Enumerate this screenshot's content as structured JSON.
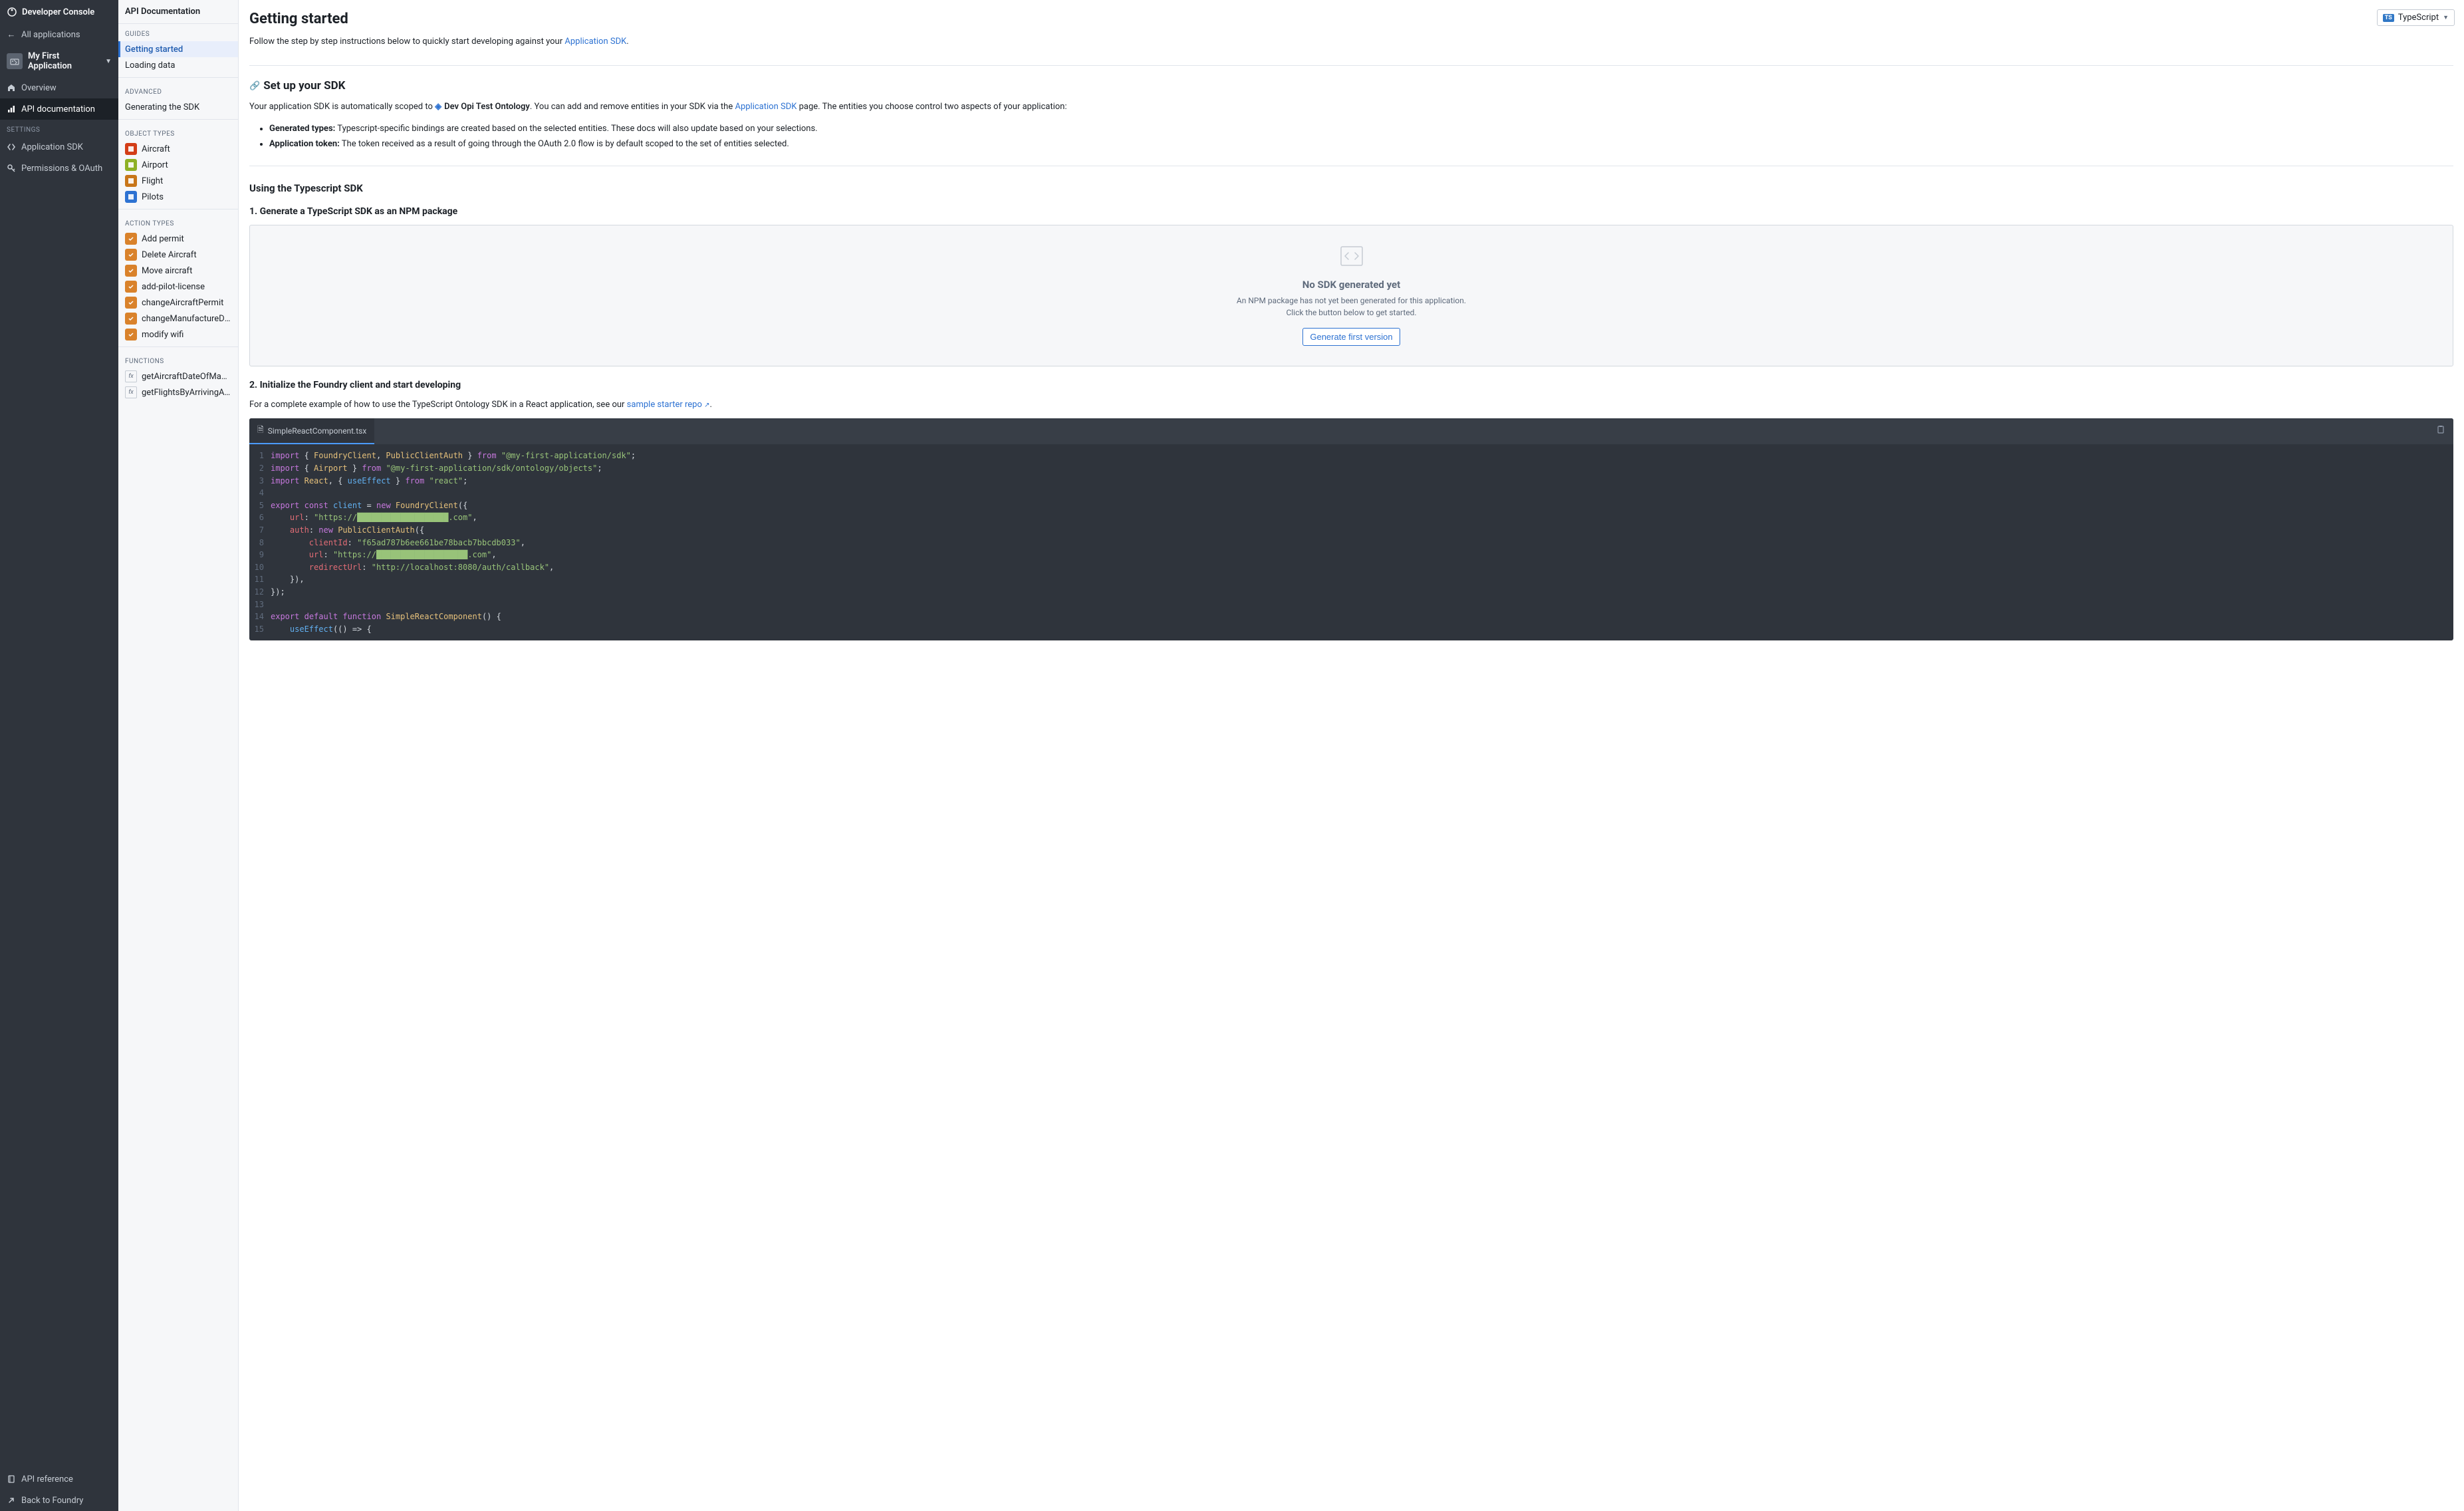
{
  "leftSidebar": {
    "title": "Developer Console",
    "allApps": "All applications",
    "appName": "My First Application",
    "nav": [
      {
        "icon": "home",
        "label": "Overview"
      },
      {
        "icon": "chart",
        "label": "API documentation",
        "active": true
      }
    ],
    "settingsLabel": "SETTINGS",
    "settings": [
      {
        "icon": "code",
        "label": "Application SDK"
      },
      {
        "icon": "key",
        "label": "Permissions & OAuth"
      }
    ],
    "footer": [
      {
        "icon": "book",
        "label": "API reference"
      },
      {
        "icon": "arrow-up-right",
        "label": "Back to Foundry"
      }
    ]
  },
  "midSidebar": {
    "title": "API Documentation",
    "sections": [
      {
        "label": "GUIDES",
        "items": [
          {
            "label": "Getting started",
            "active": true
          },
          {
            "label": "Loading data"
          }
        ]
      },
      {
        "label": "ADVANCED",
        "items": [
          {
            "label": "Generating the SDK"
          }
        ]
      },
      {
        "label": "OBJECT TYPES",
        "items": [
          {
            "icon": "obj",
            "color": "#d33d17",
            "label": "Aircraft"
          },
          {
            "icon": "obj",
            "color": "#8eb125",
            "label": "Airport"
          },
          {
            "icon": "obj",
            "color": "#c87619",
            "label": "Flight"
          },
          {
            "icon": "obj",
            "color": "#2d72d2",
            "label": "Pilots"
          }
        ]
      },
      {
        "label": "ACTION TYPES",
        "items": [
          {
            "icon": "action",
            "label": "Add permit"
          },
          {
            "icon": "action",
            "label": "Delete Aircraft"
          },
          {
            "icon": "action",
            "label": "Move aircraft"
          },
          {
            "icon": "action",
            "label": "add-pilot-license"
          },
          {
            "icon": "action",
            "label": "changeAircraftPermit"
          },
          {
            "icon": "action",
            "label": "changeManufactureDate"
          },
          {
            "icon": "action",
            "label": "modify wifi"
          }
        ]
      },
      {
        "label": "FUNCTIONS",
        "items": [
          {
            "icon": "fx",
            "label": "getAircraftDateOfManufacture"
          },
          {
            "icon": "fx",
            "label": "getFlightsByArrivingAirportC…"
          }
        ]
      }
    ]
  },
  "main": {
    "langSelector": "TypeScript",
    "title": "Getting started",
    "intro_prefix": "Follow the step by step instructions below to quickly start developing against your ",
    "intro_link": "Application SDK",
    "intro_suffix": ".",
    "section1_heading": "Set up your SDK",
    "section1_p1_a": "Your application SDK is automatically scoped to ",
    "section1_ontology": "Dev Opi Test Ontology",
    "section1_p1_b": ". You can add and remove entities in your SDK via the ",
    "section1_p1_link": "Application SDK",
    "section1_p1_c": " page. The entities you choose control two aspects of your application:",
    "bullets": [
      {
        "label": "Generated types:",
        "text": " Typescript-specific bindings are created based on the selected entities. These docs will also update based on your selections."
      },
      {
        "label": "Application token:",
        "text": " The token received as a result of going through the OAuth 2.0 flow is by default scoped to the set of entities selected."
      }
    ],
    "section2_heading": "Using the Typescript SDK",
    "step1_heading": "1. Generate a TypeScript SDK as an NPM package",
    "emptyCard": {
      "title": "No SDK generated yet",
      "desc1": "An NPM package has not yet been generated for this application.",
      "desc2": "Click the button below to get started.",
      "button": "Generate first version"
    },
    "step2_heading": "2. Initialize the Foundry client and start developing",
    "step2_p_a": "For a complete example of how to use the TypeScript Ontology SDK in a React application, see our ",
    "step2_p_link": "sample starter repo",
    "step2_p_b": ".",
    "codeFile": "SimpleReactComponent.tsx",
    "codeLines": [
      "import { FoundryClient, PublicClientAuth } from \"@my-first-application/sdk\";",
      "import { Airport } from \"@my-first-application/sdk/ontology/objects\";",
      "import React, { useEffect } from \"react\";",
      "",
      "export const client = new FoundryClient({",
      "    url: \"https://███████████████████.com\",",
      "    auth: new PublicClientAuth({",
      "        clientId: \"f65ad787b6ee661be78bacb7bbcdb033\",",
      "        url: \"https://███████████████████.com\",",
      "        redirectUrl: \"http://localhost:8080/auth/callback\",",
      "    }),",
      "});",
      "",
      "export default function SimpleReactComponent() {",
      "    useEffect(() => {"
    ]
  }
}
